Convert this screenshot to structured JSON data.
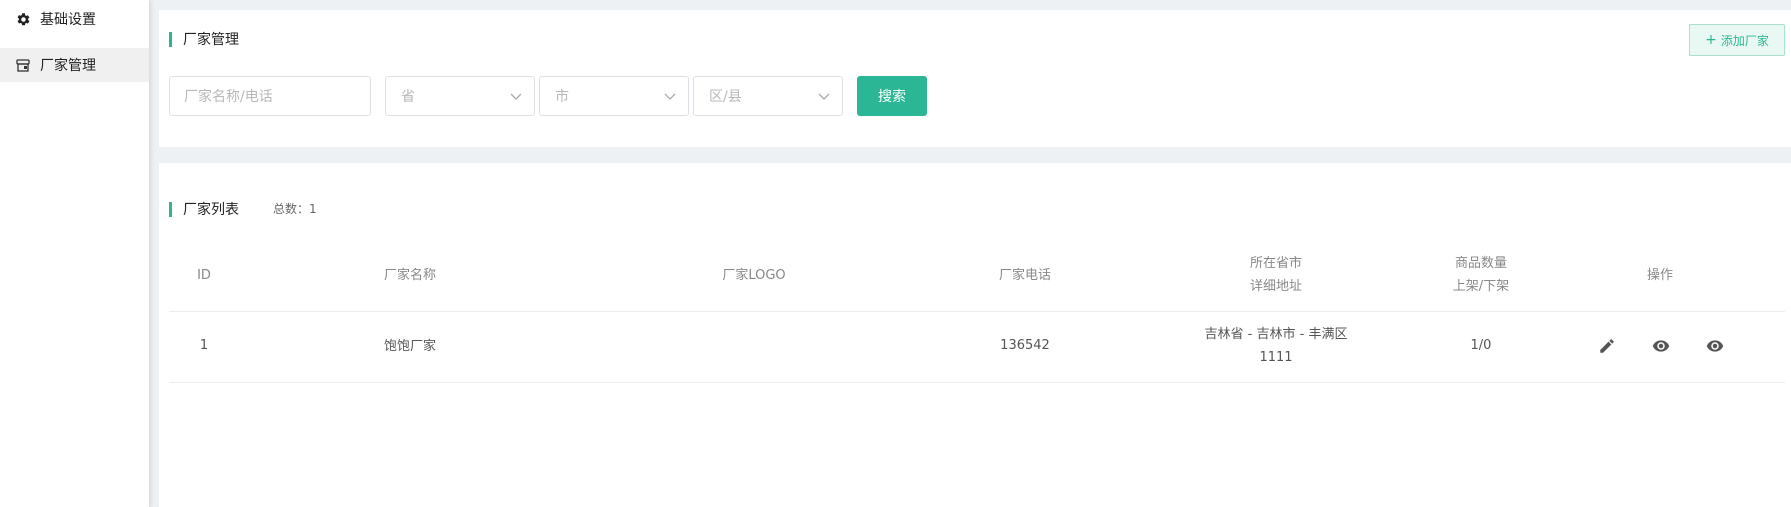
{
  "sidebar": {
    "items": [
      {
        "label": "基础设置",
        "icon": "gear-icon"
      },
      {
        "label": "厂家管理",
        "icon": "store-icon"
      }
    ]
  },
  "search_panel": {
    "title": "厂家管理",
    "add_button": {
      "icon": "plus-icon",
      "label": "添加厂家"
    },
    "name_input": {
      "placeholder": "厂家名称/电话",
      "value": ""
    },
    "province_select": {
      "placeholder": "省"
    },
    "city_select": {
      "placeholder": "市"
    },
    "district_select": {
      "placeholder": "区/县"
    },
    "search_button": "搜索"
  },
  "list_panel": {
    "title": "厂家列表",
    "total_text": "总数：1",
    "columns": {
      "id": "ID",
      "name": "厂家名称",
      "logo": "厂家LOGO",
      "phone": "厂家电话",
      "region_line1": "所在省市",
      "region_line2": "详细地址",
      "goods_line1": "商品数量",
      "goods_line2": "上架/下架",
      "actions": "操作"
    },
    "rows": [
      {
        "id": "1",
        "name": "饱饱厂家",
        "logo": "",
        "phone": "136542",
        "region": "吉林省 - 吉林市 - 丰满区",
        "address": "1111",
        "goods": "1/0",
        "actions": [
          "edit-icon",
          "view-icon",
          "view-icon"
        ]
      }
    ]
  },
  "colors": {
    "accent": "#2bb795",
    "page_bg": "#edf1f4"
  }
}
